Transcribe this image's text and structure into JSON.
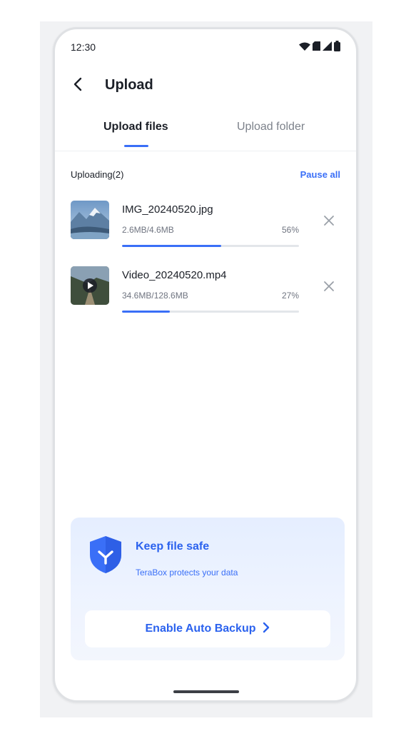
{
  "status_bar": {
    "time": "12:30"
  },
  "header": {
    "title": "Upload"
  },
  "tabs": [
    {
      "label": "Upload files",
      "active": true
    },
    {
      "label": "Upload folder",
      "active": false
    }
  ],
  "section": {
    "label": "Uploading(2)",
    "pause_all": "Pause all"
  },
  "uploads": [
    {
      "name": "IMG_20240520.jpg",
      "size": "2.6MB/4.6MB",
      "percent_text": "56%",
      "progress": 0.56,
      "type": "image"
    },
    {
      "name": "Video_20240520.mp4",
      "size": "34.6MB/128.6MB",
      "percent_text": "27%",
      "progress": 0.27,
      "type": "video"
    }
  ],
  "promo": {
    "title": "Keep file safe",
    "subtitle": "TeraBox protects your data",
    "button_label": "Enable Auto Backup"
  },
  "colors": {
    "accent": "#3a6ff7",
    "text": "#1b1f27",
    "muted": "#6f7480"
  }
}
